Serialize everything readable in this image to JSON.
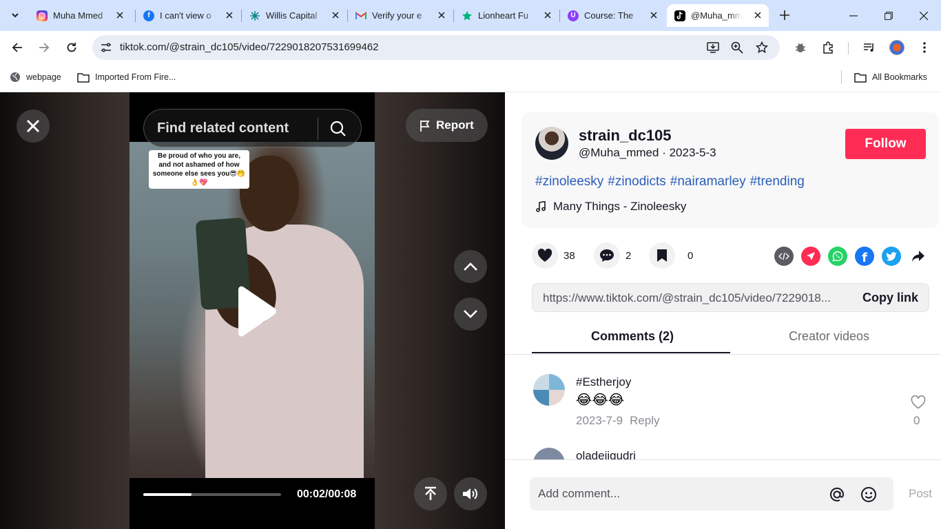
{
  "browser": {
    "tabs": [
      {
        "title": "Muha Mmed",
        "favicon": "instagram-icon",
        "color": "#d62976"
      },
      {
        "title": "I can't view o",
        "favicon": "facebook-icon",
        "color": "#1877f2"
      },
      {
        "title": "Willis Capital",
        "favicon": "willis-capital-icon",
        "color": "#0f8a8a"
      },
      {
        "title": "Verify your e",
        "favicon": "gmail-icon",
        "color": "#ea4335"
      },
      {
        "title": "Lionheart Fu",
        "favicon": "star-icon",
        "color": "#00b67a"
      },
      {
        "title": "Course: The",
        "favicon": "course-icon",
        "color": "#8a3ffc"
      },
      {
        "title": "@Muha_mm",
        "favicon": "tiktok-icon",
        "color": "#000000",
        "active": true
      }
    ],
    "url": "tiktok.com/@strain_dc105/video/7229018207531699462",
    "bookmarks": [
      {
        "label": "webpage",
        "icon": "globe-icon"
      },
      {
        "label": "Imported From Fire...",
        "icon": "folder-icon"
      }
    ],
    "all_bookmarks": "All Bookmarks"
  },
  "video": {
    "search_placeholder": "Find related content",
    "report_label": "Report",
    "sticker_text": "Be proud of who you are, and not ashamed of how someone else sees you😎🤭👌💖",
    "time": "00:02/00:08",
    "progress_percent": 35
  },
  "post": {
    "username": "strain_dc105",
    "handle_date": "@Muha_mmed · 2023-5-3",
    "follow_label": "Follow",
    "hashtags": [
      "#zinoleesky",
      "#zinodicts",
      "#nairamarley",
      "#trending"
    ],
    "music": "Many Things - Zinoleesky",
    "likes": "38",
    "comments": "2",
    "saves": "0",
    "share_icons": [
      "embed-icon",
      "send-icon",
      "whatsapp-icon",
      "facebook-icon",
      "twitter-icon",
      "share-arrow-icon"
    ],
    "link": "https://www.tiktok.com/@strain_dc105/video/7229018...",
    "copy_label": "Copy link"
  },
  "comments_tabs": {
    "comments": "Comments (2)",
    "creator": "Creator videos"
  },
  "comments": [
    {
      "user": "#Estherjoy",
      "text": "😂😂😂",
      "date": "2023-7-9",
      "reply": "Reply",
      "likes": "0"
    },
    {
      "user": "oladejiqudri"
    }
  ],
  "add_comment": {
    "placeholder": "Add comment...",
    "post_label": "Post"
  },
  "colors": {
    "accent": "#fe2c55",
    "link": "#2b5db9"
  }
}
